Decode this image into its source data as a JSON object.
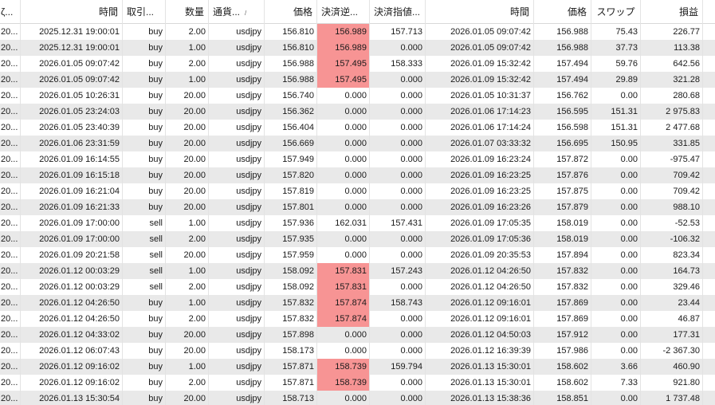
{
  "header": {
    "c0": "ζ...",
    "c1": "時間",
    "c2": "取引...",
    "c3": "数量",
    "c4": "通貨...",
    "c4_sort": "/",
    "c5": "価格",
    "c6": "決済逆...",
    "c7": "決済指値...",
    "c8": "時間",
    "c9": "価格",
    "c10": "スワップ",
    "c11": "損益"
  },
  "highlight_color": "#f79494",
  "alt_row_color": "#e9e9e9",
  "rows": [
    {
      "c0": "20...",
      "open_time": "2025.12.31 19:00:01",
      "type": "buy",
      "volume": "2.00",
      "symbol": "usdjpy",
      "price": "156.810",
      "sl": "156.989",
      "tp": "157.713",
      "close_time": "2026.01.05 09:07:42",
      "close_price": "156.988",
      "swap": "75.43",
      "profit": "226.77",
      "sl_hl": true
    },
    {
      "c0": "20...",
      "open_time": "2025.12.31 19:00:01",
      "type": "buy",
      "volume": "1.00",
      "symbol": "usdjpy",
      "price": "156.810",
      "sl": "156.989",
      "tp": "0.000",
      "close_time": "2026.01.05 09:07:42",
      "close_price": "156.988",
      "swap": "37.73",
      "profit": "113.38",
      "sl_hl": true
    },
    {
      "c0": "20...",
      "open_time": "2026.01.05 09:07:42",
      "type": "buy",
      "volume": "2.00",
      "symbol": "usdjpy",
      "price": "156.988",
      "sl": "157.495",
      "tp": "158.333",
      "close_time": "2026.01.09 15:32:42",
      "close_price": "157.494",
      "swap": "59.76",
      "profit": "642.56",
      "sl_hl": true
    },
    {
      "c0": "20...",
      "open_time": "2026.01.05 09:07:42",
      "type": "buy",
      "volume": "1.00",
      "symbol": "usdjpy",
      "price": "156.988",
      "sl": "157.495",
      "tp": "0.000",
      "close_time": "2026.01.09 15:32:42",
      "close_price": "157.494",
      "swap": "29.89",
      "profit": "321.28",
      "sl_hl": true
    },
    {
      "c0": "20...",
      "open_time": "2026.01.05 10:26:31",
      "type": "buy",
      "volume": "20.00",
      "symbol": "usdjpy",
      "price": "156.740",
      "sl": "0.000",
      "tp": "0.000",
      "close_time": "2026.01.05 10:31:37",
      "close_price": "156.762",
      "swap": "0.00",
      "profit": "280.68",
      "sl_hl": false
    },
    {
      "c0": "20...",
      "open_time": "2026.01.05 23:24:03",
      "type": "buy",
      "volume": "20.00",
      "symbol": "usdjpy",
      "price": "156.362",
      "sl": "0.000",
      "tp": "0.000",
      "close_time": "2026.01.06 17:14:23",
      "close_price": "156.595",
      "swap": "151.31",
      "profit": "2 975.83",
      "sl_hl": false
    },
    {
      "c0": "20...",
      "open_time": "2026.01.05 23:40:39",
      "type": "buy",
      "volume": "20.00",
      "symbol": "usdjpy",
      "price": "156.404",
      "sl": "0.000",
      "tp": "0.000",
      "close_time": "2026.01.06 17:14:24",
      "close_price": "156.598",
      "swap": "151.31",
      "profit": "2 477.68",
      "sl_hl": false
    },
    {
      "c0": "20...",
      "open_time": "2026.01.06 23:31:59",
      "type": "buy",
      "volume": "20.00",
      "symbol": "usdjpy",
      "price": "156.669",
      "sl": "0.000",
      "tp": "0.000",
      "close_time": "2026.01.07 03:33:32",
      "close_price": "156.695",
      "swap": "150.95",
      "profit": "331.85",
      "sl_hl": false
    },
    {
      "c0": "20...",
      "open_time": "2026.01.09 16:14:55",
      "type": "buy",
      "volume": "20.00",
      "symbol": "usdjpy",
      "price": "157.949",
      "sl": "0.000",
      "tp": "0.000",
      "close_time": "2026.01.09 16:23:24",
      "close_price": "157.872",
      "swap": "0.00",
      "profit": "-975.47",
      "sl_hl": false
    },
    {
      "c0": "20...",
      "open_time": "2026.01.09 16:15:18",
      "type": "buy",
      "volume": "20.00",
      "symbol": "usdjpy",
      "price": "157.820",
      "sl": "0.000",
      "tp": "0.000",
      "close_time": "2026.01.09 16:23:25",
      "close_price": "157.876",
      "swap": "0.00",
      "profit": "709.42",
      "sl_hl": false
    },
    {
      "c0": "20...",
      "open_time": "2026.01.09 16:21:04",
      "type": "buy",
      "volume": "20.00",
      "symbol": "usdjpy",
      "price": "157.819",
      "sl": "0.000",
      "tp": "0.000",
      "close_time": "2026.01.09 16:23:25",
      "close_price": "157.875",
      "swap": "0.00",
      "profit": "709.42",
      "sl_hl": false
    },
    {
      "c0": "20...",
      "open_time": "2026.01.09 16:21:33",
      "type": "buy",
      "volume": "20.00",
      "symbol": "usdjpy",
      "price": "157.801",
      "sl": "0.000",
      "tp": "0.000",
      "close_time": "2026.01.09 16:23:26",
      "close_price": "157.879",
      "swap": "0.00",
      "profit": "988.10",
      "sl_hl": false
    },
    {
      "c0": "20...",
      "open_time": "2026.01.09 17:00:00",
      "type": "sell",
      "volume": "1.00",
      "symbol": "usdjpy",
      "price": "157.936",
      "sl": "162.031",
      "tp": "157.431",
      "close_time": "2026.01.09 17:05:35",
      "close_price": "158.019",
      "swap": "0.00",
      "profit": "-52.53",
      "sl_hl": false
    },
    {
      "c0": "20...",
      "open_time": "2026.01.09 17:00:00",
      "type": "sell",
      "volume": "2.00",
      "symbol": "usdjpy",
      "price": "157.935",
      "sl": "0.000",
      "tp": "0.000",
      "close_time": "2026.01.09 17:05:36",
      "close_price": "158.019",
      "swap": "0.00",
      "profit": "-106.32",
      "sl_hl": false
    },
    {
      "c0": "20...",
      "open_time": "2026.01.09 20:21:58",
      "type": "sell",
      "volume": "20.00",
      "symbol": "usdjpy",
      "price": "157.959",
      "sl": "0.000",
      "tp": "0.000",
      "close_time": "2026.01.09 20:35:53",
      "close_price": "157.894",
      "swap": "0.00",
      "profit": "823.34",
      "sl_hl": false
    },
    {
      "c0": "20...",
      "open_time": "2026.01.12 00:03:29",
      "type": "sell",
      "volume": "1.00",
      "symbol": "usdjpy",
      "price": "158.092",
      "sl": "157.831",
      "tp": "157.243",
      "close_time": "2026.01.12 04:26:50",
      "close_price": "157.832",
      "swap": "0.00",
      "profit": "164.73",
      "sl_hl": true
    },
    {
      "c0": "20...",
      "open_time": "2026.01.12 00:03:29",
      "type": "sell",
      "volume": "2.00",
      "symbol": "usdjpy",
      "price": "158.092",
      "sl": "157.831",
      "tp": "0.000",
      "close_time": "2026.01.12 04:26:50",
      "close_price": "157.832",
      "swap": "0.00",
      "profit": "329.46",
      "sl_hl": true
    },
    {
      "c0": "20...",
      "open_time": "2026.01.12 04:26:50",
      "type": "buy",
      "volume": "1.00",
      "symbol": "usdjpy",
      "price": "157.832",
      "sl": "157.874",
      "tp": "158.743",
      "close_time": "2026.01.12 09:16:01",
      "close_price": "157.869",
      "swap": "0.00",
      "profit": "23.44",
      "sl_hl": true
    },
    {
      "c0": "20...",
      "open_time": "2026.01.12 04:26:50",
      "type": "buy",
      "volume": "2.00",
      "symbol": "usdjpy",
      "price": "157.832",
      "sl": "157.874",
      "tp": "0.000",
      "close_time": "2026.01.12 09:16:01",
      "close_price": "157.869",
      "swap": "0.00",
      "profit": "46.87",
      "sl_hl": true
    },
    {
      "c0": "20...",
      "open_time": "2026.01.12 04:33:02",
      "type": "buy",
      "volume": "20.00",
      "symbol": "usdjpy",
      "price": "157.898",
      "sl": "0.000",
      "tp": "0.000",
      "close_time": "2026.01.12 04:50:03",
      "close_price": "157.912",
      "swap": "0.00",
      "profit": "177.31",
      "sl_hl": false
    },
    {
      "c0": "20...",
      "open_time": "2026.01.12 06:07:43",
      "type": "buy",
      "volume": "20.00",
      "symbol": "usdjpy",
      "price": "158.173",
      "sl": "0.000",
      "tp": "0.000",
      "close_time": "2026.01.12 16:39:39",
      "close_price": "157.986",
      "swap": "0.00",
      "profit": "-2 367.30",
      "sl_hl": false
    },
    {
      "c0": "20...",
      "open_time": "2026.01.12 09:16:02",
      "type": "buy",
      "volume": "1.00",
      "symbol": "usdjpy",
      "price": "157.871",
      "sl": "158.739",
      "tp": "159.794",
      "close_time": "2026.01.13 15:30:01",
      "close_price": "158.602",
      "swap": "3.66",
      "profit": "460.90",
      "sl_hl": true
    },
    {
      "c0": "20...",
      "open_time": "2026.01.12 09:16:02",
      "type": "buy",
      "volume": "2.00",
      "symbol": "usdjpy",
      "price": "157.871",
      "sl": "158.739",
      "tp": "0.000",
      "close_time": "2026.01.13 15:30:01",
      "close_price": "158.602",
      "swap": "7.33",
      "profit": "921.80",
      "sl_hl": true
    },
    {
      "c0": "20...",
      "open_time": "2026.01.13 15:30:54",
      "type": "buy",
      "volume": "20.00",
      "symbol": "usdjpy",
      "price": "158.713",
      "sl": "0.000",
      "tp": "0.000",
      "close_time": "2026.01.13 15:38:36",
      "close_price": "158.851",
      "swap": "0.00",
      "profit": "1 737.48",
      "sl_hl": false
    }
  ]
}
